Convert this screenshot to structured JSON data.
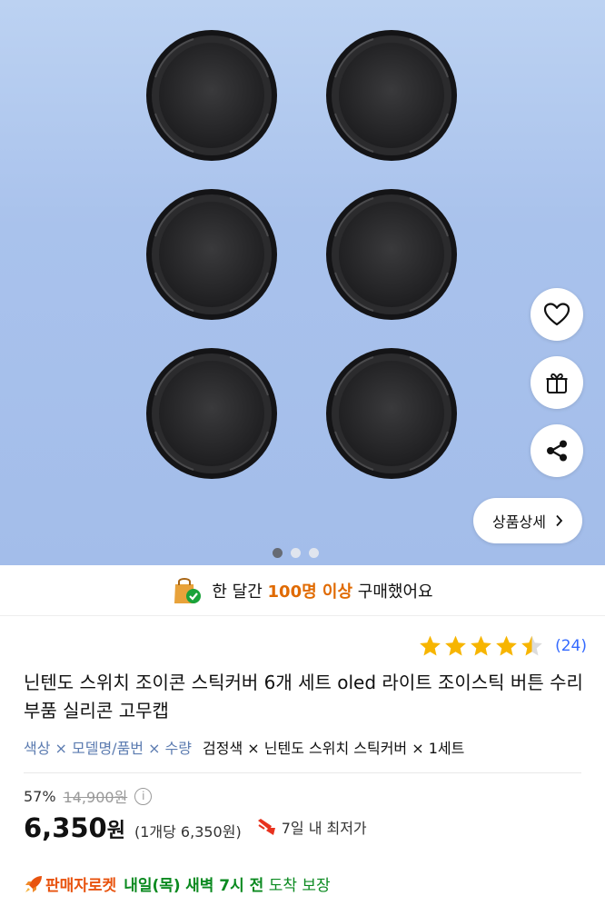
{
  "hero": {
    "image_alt": "black silicone thumbstick caps x6",
    "detail_button_label": "상품상세",
    "carousel": {
      "total": 3,
      "active": 1
    }
  },
  "actions": {
    "wishlist_icon": "heart-icon",
    "gift_icon": "gift-icon",
    "share_icon": "share-icon"
  },
  "banner": {
    "prefix": "한 달간",
    "highlight": "100명 이상",
    "suffix": "구매했어요"
  },
  "rating": {
    "stars": 4.5,
    "count": "(24)"
  },
  "product": {
    "title": "닌텐도 스위치 조이콘 스틱커버 6개 세트 oled 라이트 조이스틱 버튼 수리부품 실리콘 고무캡",
    "option_labels": "색상 × 모델명/품번 × 수량",
    "option_values": "검정색 × 닌텐도 스위치 스틱커버 × 1세트"
  },
  "pricing": {
    "discount_rate": "57%",
    "original_price": "14,900원",
    "price": "6,350",
    "currency": "원",
    "unit_price": "(1개당 6,350원)",
    "lowest_badge": "7일 내 최저가"
  },
  "delivery": {
    "type_label": "판매자로켓",
    "date": "내일(목)",
    "time": "새벽 7시 전",
    "suffix": "도착 보장"
  },
  "colors": {
    "accent_blue": "#346aff",
    "highlight_orange": "#e06a00",
    "rocket_orange": "#e8530e",
    "delivery_green": "#0b8a20",
    "star_yellow": "#f7b500"
  }
}
